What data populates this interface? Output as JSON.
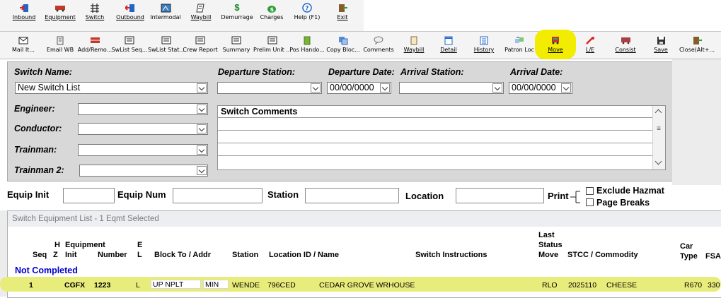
{
  "toolbar_top": [
    {
      "label": "Inbound",
      "icon": "inbound-icon"
    },
    {
      "label": "Equipment",
      "icon": "equipment-icon"
    },
    {
      "label": "Switch",
      "icon": "switch-icon"
    },
    {
      "label": "Outbound",
      "icon": "outbound-icon"
    },
    {
      "label": "Intermodal",
      "icon": "intermodal-icon"
    },
    {
      "label": "Waybill",
      "icon": "waybill-icon"
    },
    {
      "label": "Demurrage",
      "icon": "demurrage-icon"
    },
    {
      "label": "Charges",
      "icon": "charges-icon"
    },
    {
      "label": "Help (F1)",
      "icon": "help-icon"
    },
    {
      "label": "Exit",
      "icon": "exit-icon"
    }
  ],
  "toolbar_bottom": [
    {
      "label": "Mail It...",
      "icon": "mail-icon"
    },
    {
      "label": "Email WB",
      "icon": "email-waybill-icon"
    },
    {
      "label": "Add/Remo...",
      "icon": "add-remove-icon"
    },
    {
      "label": "SwList Seq...",
      "icon": "swlist-seq-icon"
    },
    {
      "label": "SwList Stat...",
      "icon": "swlist-status-icon"
    },
    {
      "label": "Crew Report",
      "icon": "crew-report-icon"
    },
    {
      "label": "Summary",
      "icon": "summary-icon"
    },
    {
      "label": "Prelim Unit ...",
      "icon": "prelim-unit-icon"
    },
    {
      "label": "Pos Hando...",
      "icon": "pos-handoff-icon"
    },
    {
      "label": "Copy Bloc...",
      "icon": "copy-block-icon"
    },
    {
      "label": "Comments",
      "icon": "comments-icon"
    },
    {
      "label": "Waybill",
      "icon": "waybill-icon"
    },
    {
      "label": "Detail",
      "icon": "detail-icon"
    },
    {
      "label": "History",
      "icon": "history-icon"
    },
    {
      "label": "Patron Loc",
      "icon": "patron-location-icon"
    },
    {
      "label": "Move",
      "icon": "move-icon"
    },
    {
      "label": "L/E",
      "icon": "load-empty-icon"
    },
    {
      "label": "Consist",
      "icon": "consist-icon"
    },
    {
      "label": "Save",
      "icon": "save-icon"
    },
    {
      "label": "Close(Alt+...",
      "icon": "close-icon"
    }
  ],
  "form": {
    "switch_name_label": "Switch Name:",
    "switch_name_value": "New Switch List",
    "departure_station_label": "Departure Station:",
    "departure_station_value": "",
    "departure_date_label": "Departure Date:",
    "departure_date_value": "00/00/0000",
    "arrival_station_label": "Arrival Station:",
    "arrival_station_value": "",
    "arrival_date_label": "Arrival Date:",
    "arrival_date_value": "00/00/0000",
    "engineer_label": "Engineer:",
    "conductor_label": "Conductor:",
    "trainman_label": "Trainman:",
    "trainman2_label": "Trainman 2:",
    "comments_label": "Switch Comments"
  },
  "filter": {
    "equip_init_label": "Equip Init",
    "equip_num_label": "Equip Num",
    "station_label": "Station",
    "location_label": "Location",
    "print_label": "Print",
    "exclude_hazmat_label": "Exclude Hazmat",
    "page_breaks_label": "Page Breaks"
  },
  "list": {
    "title": "Switch Equipment List - 1 Eqmt Selected",
    "headers": {
      "seq": "Seq",
      "h": "H",
      "z": "Z",
      "equipment": "Equipment",
      "init": "Init",
      "number": "Number",
      "e": "E",
      "l": "L",
      "block_to": "Block To / Addr",
      "station": "Station",
      "location": "Location ID / Name",
      "instructions": "Switch Instructions",
      "last": "Last",
      "status": "Status",
      "move": "Move",
      "stcc": "STCC / Commodity",
      "car": "Car",
      "type": "Type",
      "fsa": "FSA"
    },
    "group_label": "Not Completed",
    "rows": [
      {
        "seq": "1",
        "init": "CGFX",
        "number": "1223",
        "el": "L",
        "block_to": "UP NPLT",
        "addr": "MIN",
        "station": "WENDE",
        "location_id": "796CED",
        "location_name": "CEDAR GROVE WRHOUSE",
        "move": "RLO",
        "stcc": "2025110",
        "commodity": "CHEESE",
        "car_type": "R670",
        "fsa": "330"
      }
    ]
  },
  "colors": {
    "highlight": "#e8ec7a",
    "group_label": "#0000cc",
    "panel": "#d8d8d8"
  }
}
